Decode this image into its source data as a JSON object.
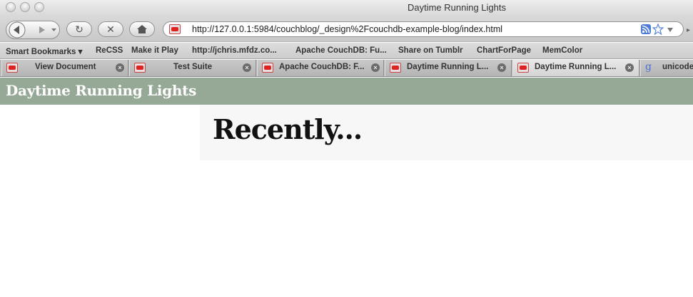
{
  "window": {
    "title": "Daytime Running Lights"
  },
  "toolbar": {
    "url": "http://127.0.0.1:5984/couchblog/_design%2Fcouchdb-example-blog/index.html"
  },
  "bookmarks": [
    {
      "label": "Smart Bookmarks ▾"
    },
    {
      "label": "ReCSS"
    },
    {
      "label": "Make it Play"
    },
    {
      "label": "http://jchris.mfdz.co..."
    },
    {
      "label": "Apache CouchDB: Fu..."
    },
    {
      "label": "Share on Tumblr"
    },
    {
      "label": "ChartForPage"
    },
    {
      "label": "MemColor"
    }
  ],
  "tabs": [
    {
      "label": "View Document"
    },
    {
      "label": "Test Suite"
    },
    {
      "label": "Apache CouchDB: F..."
    },
    {
      "label": "Daytime Running L..."
    },
    {
      "label": "Daytime Running L..."
    },
    {
      "label": "unicode"
    }
  ],
  "page": {
    "site_title": "Daytime Running Lights",
    "heading": "Recently..."
  },
  "colors": {
    "header": "#96a996",
    "panel": "#f7f7f7"
  }
}
